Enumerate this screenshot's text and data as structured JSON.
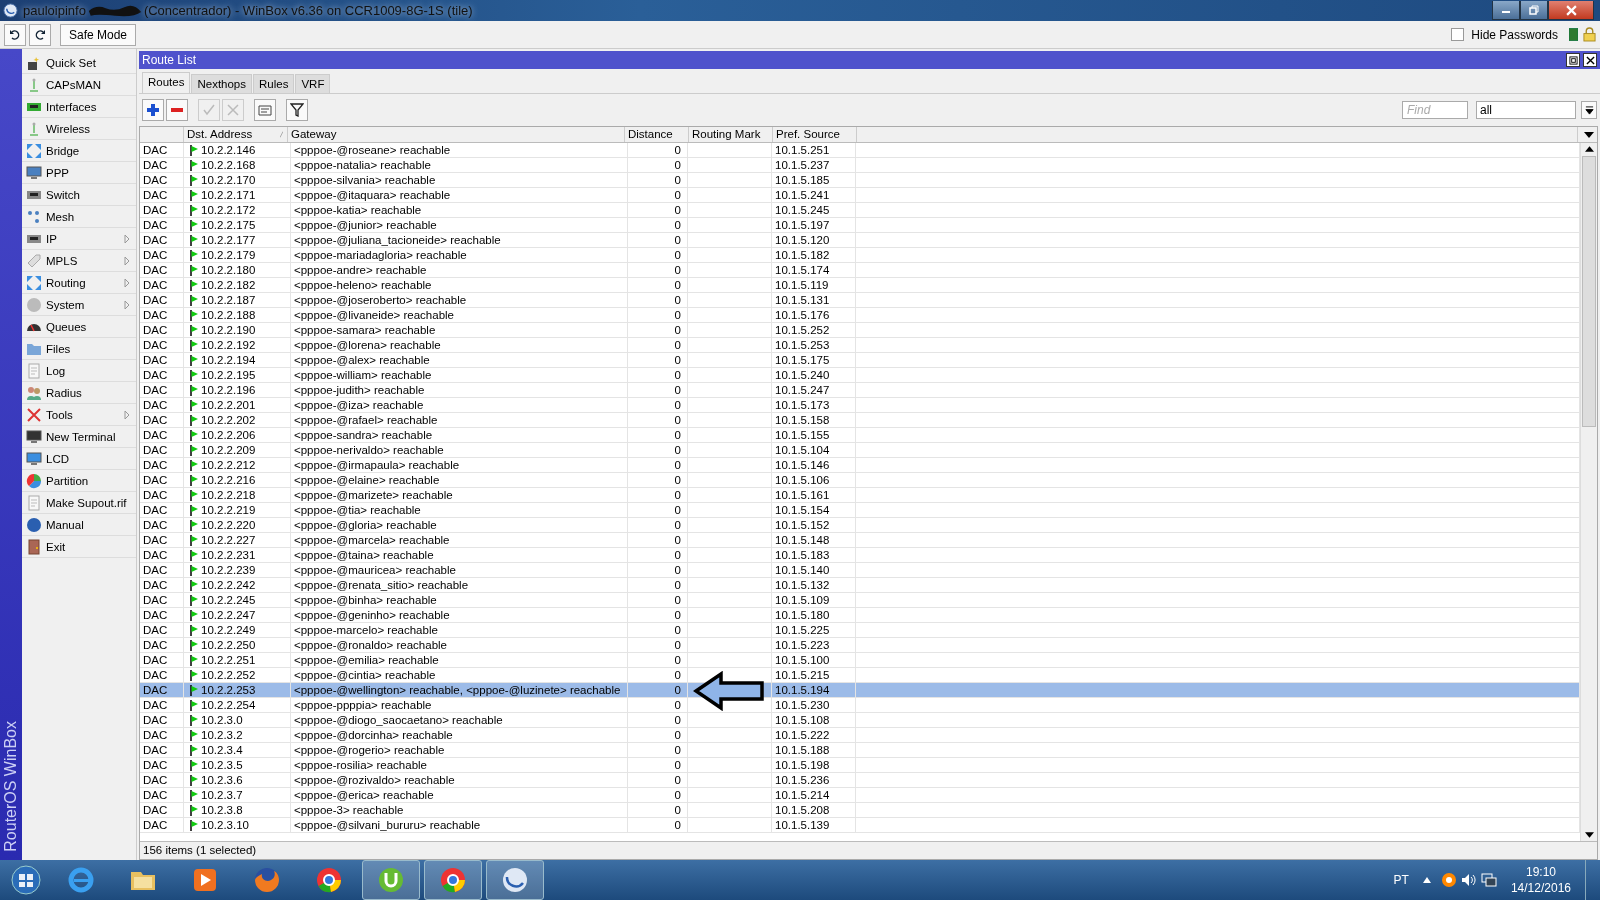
{
  "window": {
    "title_start": "pauloipinfo",
    "title_end": "(Concentrador) - WinBox v6.36 on CCR1009-8G-1S (tile)"
  },
  "toolbar": {
    "safe_mode": "Safe Mode",
    "hide_passwords": {
      "label": "Hide Passwords",
      "checked": false
    }
  },
  "side_label": "RouterOS WinBox",
  "sidebar": [
    {
      "label": "Quick Set",
      "submenu": false
    },
    {
      "label": "CAPsMAN",
      "submenu": false
    },
    {
      "label": "Interfaces",
      "submenu": false
    },
    {
      "label": "Wireless",
      "submenu": false
    },
    {
      "label": "Bridge",
      "submenu": false
    },
    {
      "label": "PPP",
      "submenu": false
    },
    {
      "label": "Switch",
      "submenu": false
    },
    {
      "label": "Mesh",
      "submenu": false
    },
    {
      "label": "IP",
      "submenu": true
    },
    {
      "label": "MPLS",
      "submenu": true
    },
    {
      "label": "Routing",
      "submenu": true
    },
    {
      "label": "System",
      "submenu": true
    },
    {
      "label": "Queues",
      "submenu": false
    },
    {
      "label": "Files",
      "submenu": false
    },
    {
      "label": "Log",
      "submenu": false
    },
    {
      "label": "Radius",
      "submenu": false
    },
    {
      "label": "Tools",
      "submenu": true
    },
    {
      "label": "New Terminal",
      "submenu": false
    },
    {
      "label": "LCD",
      "submenu": false
    },
    {
      "label": "Partition",
      "submenu": false
    },
    {
      "label": "Make Supout.rif",
      "submenu": false
    },
    {
      "label": "Manual",
      "submenu": false
    },
    {
      "label": "Exit",
      "submenu": false
    }
  ],
  "route_list": {
    "title": "Route List",
    "tabs": [
      {
        "label": "Routes",
        "selected": true
      },
      {
        "label": "Nexthops",
        "selected": false
      },
      {
        "label": "Rules",
        "selected": false
      },
      {
        "label": "VRF",
        "selected": false
      }
    ],
    "tools": [
      {
        "kind": "add",
        "disabled": false
      },
      {
        "kind": "remove",
        "disabled": false
      },
      {
        "kind": "enable",
        "disabled": true
      },
      {
        "kind": "disable",
        "disabled": true
      },
      {
        "kind": "comment",
        "disabled": false
      },
      {
        "kind": "filter",
        "disabled": false
      }
    ],
    "search": {
      "placeholder": "Find"
    },
    "filter_value": "all",
    "columns": [
      {
        "label": "Dst. Address",
        "sorted": true
      },
      {
        "label": "Gateway",
        "sorted": false
      },
      {
        "label": "Distance",
        "sorted": false
      },
      {
        "label": "Routing Mark",
        "sorted": false
      },
      {
        "label": "Pref. Source",
        "sorted": false
      }
    ],
    "rows": [
      {
        "flags": "DAC",
        "dst": "10.2.2.146",
        "gateway": "<pppoe-@roseane> reachable",
        "distance": "0",
        "pref_source": "10.1.5.251",
        "selected": false
      },
      {
        "flags": "DAC",
        "dst": "10.2.2.168",
        "gateway": "<pppoe-natalia> reachable",
        "distance": "0",
        "pref_source": "10.1.5.237",
        "selected": false
      },
      {
        "flags": "DAC",
        "dst": "10.2.2.170",
        "gateway": "<pppoe-silvania> reachable",
        "distance": "0",
        "pref_source": "10.1.5.185",
        "selected": false
      },
      {
        "flags": "DAC",
        "dst": "10.2.2.171",
        "gateway": "<pppoe-@itaquara> reachable",
        "distance": "0",
        "pref_source": "10.1.5.241",
        "selected": false
      },
      {
        "flags": "DAC",
        "dst": "10.2.2.172",
        "gateway": "<pppoe-katia> reachable",
        "distance": "0",
        "pref_source": "10.1.5.245",
        "selected": false
      },
      {
        "flags": "DAC",
        "dst": "10.2.2.175",
        "gateway": "<pppoe-@junior> reachable",
        "distance": "0",
        "pref_source": "10.1.5.197",
        "selected": false
      },
      {
        "flags": "DAC",
        "dst": "10.2.2.177",
        "gateway": "<pppoe-@juliana_tacioneide> reachable",
        "distance": "0",
        "pref_source": "10.1.5.120",
        "selected": false
      },
      {
        "flags": "DAC",
        "dst": "10.2.2.179",
        "gateway": "<pppoe-mariadagloria> reachable",
        "distance": "0",
        "pref_source": "10.1.5.182",
        "selected": false
      },
      {
        "flags": "DAC",
        "dst": "10.2.2.180",
        "gateway": "<pppoe-andre> reachable",
        "distance": "0",
        "pref_source": "10.1.5.174",
        "selected": false
      },
      {
        "flags": "DAC",
        "dst": "10.2.2.182",
        "gateway": "<pppoe-heleno> reachable",
        "distance": "0",
        "pref_source": "10.1.5.119",
        "selected": false
      },
      {
        "flags": "DAC",
        "dst": "10.2.2.187",
        "gateway": "<pppoe-@joseroberto> reachable",
        "distance": "0",
        "pref_source": "10.1.5.131",
        "selected": false
      },
      {
        "flags": "DAC",
        "dst": "10.2.2.188",
        "gateway": "<pppoe-@livaneide> reachable",
        "distance": "0",
        "pref_source": "10.1.5.176",
        "selected": false
      },
      {
        "flags": "DAC",
        "dst": "10.2.2.190",
        "gateway": "<pppoe-samara> reachable",
        "distance": "0",
        "pref_source": "10.1.5.252",
        "selected": false
      },
      {
        "flags": "DAC",
        "dst": "10.2.2.192",
        "gateway": "<pppoe-@lorena> reachable",
        "distance": "0",
        "pref_source": "10.1.5.253",
        "selected": false
      },
      {
        "flags": "DAC",
        "dst": "10.2.2.194",
        "gateway": "<pppoe-@alex> reachable",
        "distance": "0",
        "pref_source": "10.1.5.175",
        "selected": false
      },
      {
        "flags": "DAC",
        "dst": "10.2.2.195",
        "gateway": "<pppoe-william> reachable",
        "distance": "0",
        "pref_source": "10.1.5.240",
        "selected": false
      },
      {
        "flags": "DAC",
        "dst": "10.2.2.196",
        "gateway": "<pppoe-judith> reachable",
        "distance": "0",
        "pref_source": "10.1.5.247",
        "selected": false
      },
      {
        "flags": "DAC",
        "dst": "10.2.2.201",
        "gateway": "<pppoe-@iza> reachable",
        "distance": "0",
        "pref_source": "10.1.5.173",
        "selected": false
      },
      {
        "flags": "DAC",
        "dst": "10.2.2.202",
        "gateway": "<pppoe-@rafael> reachable",
        "distance": "0",
        "pref_source": "10.1.5.158",
        "selected": false
      },
      {
        "flags": "DAC",
        "dst": "10.2.2.206",
        "gateway": "<pppoe-sandra> reachable",
        "distance": "0",
        "pref_source": "10.1.5.155",
        "selected": false
      },
      {
        "flags": "DAC",
        "dst": "10.2.2.209",
        "gateway": "<pppoe-nerivaldo> reachable",
        "distance": "0",
        "pref_source": "10.1.5.104",
        "selected": false
      },
      {
        "flags": "DAC",
        "dst": "10.2.2.212",
        "gateway": "<pppoe-@irmapaula> reachable",
        "distance": "0",
        "pref_source": "10.1.5.146",
        "selected": false
      },
      {
        "flags": "DAC",
        "dst": "10.2.2.216",
        "gateway": "<pppoe-@elaine> reachable",
        "distance": "0",
        "pref_source": "10.1.5.106",
        "selected": false
      },
      {
        "flags": "DAC",
        "dst": "10.2.2.218",
        "gateway": "<pppoe-@marizete> reachable",
        "distance": "0",
        "pref_source": "10.1.5.161",
        "selected": false
      },
      {
        "flags": "DAC",
        "dst": "10.2.2.219",
        "gateway": "<pppoe-@tia> reachable",
        "distance": "0",
        "pref_source": "10.1.5.154",
        "selected": false
      },
      {
        "flags": "DAC",
        "dst": "10.2.2.220",
        "gateway": "<pppoe-@gloria> reachable",
        "distance": "0",
        "pref_source": "10.1.5.152",
        "selected": false
      },
      {
        "flags": "DAC",
        "dst": "10.2.2.227",
        "gateway": "<pppoe-@marcela> reachable",
        "distance": "0",
        "pref_source": "10.1.5.148",
        "selected": false
      },
      {
        "flags": "DAC",
        "dst": "10.2.2.231",
        "gateway": "<pppoe-@taina> reachable",
        "distance": "0",
        "pref_source": "10.1.5.183",
        "selected": false
      },
      {
        "flags": "DAC",
        "dst": "10.2.2.239",
        "gateway": "<pppoe-@mauricea> reachable",
        "distance": "0",
        "pref_source": "10.1.5.140",
        "selected": false
      },
      {
        "flags": "DAC",
        "dst": "10.2.2.242",
        "gateway": "<pppoe-@renata_sitio> reachable",
        "distance": "0",
        "pref_source": "10.1.5.132",
        "selected": false
      },
      {
        "flags": "DAC",
        "dst": "10.2.2.245",
        "gateway": "<pppoe-@binha> reachable",
        "distance": "0",
        "pref_source": "10.1.5.109",
        "selected": false
      },
      {
        "flags": "DAC",
        "dst": "10.2.2.247",
        "gateway": "<pppoe-@geninho> reachable",
        "distance": "0",
        "pref_source": "10.1.5.180",
        "selected": false
      },
      {
        "flags": "DAC",
        "dst": "10.2.2.249",
        "gateway": "<pppoe-marcelo> reachable",
        "distance": "0",
        "pref_source": "10.1.5.225",
        "selected": false
      },
      {
        "flags": "DAC",
        "dst": "10.2.2.250",
        "gateway": "<pppoe-@ronaldo> reachable",
        "distance": "0",
        "pref_source": "10.1.5.223",
        "selected": false
      },
      {
        "flags": "DAC",
        "dst": "10.2.2.251",
        "gateway": "<pppoe-@emilia> reachable",
        "distance": "0",
        "pref_source": "10.1.5.100",
        "selected": false
      },
      {
        "flags": "DAC",
        "dst": "10.2.2.252",
        "gateway": "<pppoe-@cintia> reachable",
        "distance": "0",
        "pref_source": "10.1.5.215",
        "selected": false
      },
      {
        "flags": "DAC",
        "dst": "10.2.2.253",
        "gateway": "<pppoe-@wellington> reachable, <pppoe-@luzinete> reachable",
        "distance": "0",
        "pref_source": "10.1.5.194",
        "selected": true
      },
      {
        "flags": "DAC",
        "dst": "10.2.2.254",
        "gateway": "<pppoe-ppppia> reachable",
        "distance": "0",
        "pref_source": "10.1.5.230",
        "selected": false
      },
      {
        "flags": "DAC",
        "dst": "10.2.3.0",
        "gateway": "<pppoe-@diogo_saocaetano> reachable",
        "distance": "0",
        "pref_source": "10.1.5.108",
        "selected": false
      },
      {
        "flags": "DAC",
        "dst": "10.2.3.2",
        "gateway": "<pppoe-@dorcinha> reachable",
        "distance": "0",
        "pref_source": "10.1.5.222",
        "selected": false
      },
      {
        "flags": "DAC",
        "dst": "10.2.3.4",
        "gateway": "<pppoe-@rogerio> reachable",
        "distance": "0",
        "pref_source": "10.1.5.188",
        "selected": false
      },
      {
        "flags": "DAC",
        "dst": "10.2.3.5",
        "gateway": "<pppoe-rosilia> reachable",
        "distance": "0",
        "pref_source": "10.1.5.198",
        "selected": false
      },
      {
        "flags": "DAC",
        "dst": "10.2.3.6",
        "gateway": "<pppoe-@rozivaldo> reachable",
        "distance": "0",
        "pref_source": "10.1.5.236",
        "selected": false
      },
      {
        "flags": "DAC",
        "dst": "10.2.3.7",
        "gateway": "<pppoe-@erica> reachable",
        "distance": "0",
        "pref_source": "10.1.5.214",
        "selected": false
      },
      {
        "flags": "DAC",
        "dst": "10.2.3.8",
        "gateway": "<pppoe-3> reachable",
        "distance": "0",
        "pref_source": "10.1.5.208",
        "selected": false
      },
      {
        "flags": "DAC",
        "dst": "10.2.3.10",
        "gateway": "<pppoe-@silvani_bururu> reachable",
        "distance": "0",
        "pref_source": "10.1.5.139",
        "selected": false
      }
    ],
    "status": "156 items (1 selected)"
  },
  "taskbar": {
    "apps": [
      {
        "kind": "ie",
        "running": false
      },
      {
        "kind": "explorer",
        "running": false
      },
      {
        "kind": "media",
        "running": false
      },
      {
        "kind": "firefox",
        "running": false
      },
      {
        "kind": "chrome",
        "running": false
      },
      {
        "kind": "torrent",
        "running": true
      },
      {
        "kind": "chrome",
        "running": true
      },
      {
        "kind": "winbox",
        "running": true
      }
    ],
    "language": "PT",
    "time": "19:10",
    "date": "14/12/2016"
  }
}
